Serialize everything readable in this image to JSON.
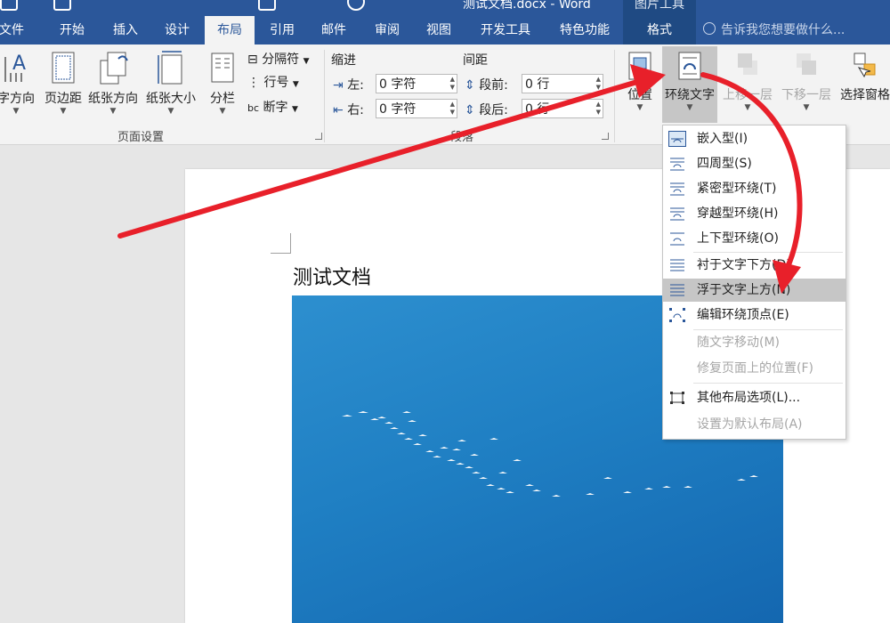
{
  "window": {
    "title": "测试文档.docx - Word",
    "context_tab": "图片工具"
  },
  "tabs": [
    {
      "label": "文件"
    },
    {
      "label": "开始"
    },
    {
      "label": "插入"
    },
    {
      "label": "设计"
    },
    {
      "label": "布局"
    },
    {
      "label": "引用"
    },
    {
      "label": "邮件"
    },
    {
      "label": "审阅"
    },
    {
      "label": "视图"
    },
    {
      "label": "开发工具"
    },
    {
      "label": "特色功能"
    },
    {
      "label": "格式"
    }
  ],
  "tell_me": "告诉我您想要做什么...",
  "ribbon": {
    "page_setup": {
      "text_direction": "字方向",
      "margins": "页边距",
      "orientation": "纸张方向",
      "size": "纸张大小",
      "columns": "分栏",
      "breaks": "分隔符",
      "line_numbers": "行号",
      "hyphenation": "断字",
      "group_label": "页面设置"
    },
    "paragraph": {
      "indent_label": "缩进",
      "spacing_label": "间距",
      "left_label": "左:",
      "left_value": "0 字符",
      "right_label": "右:",
      "right_value": "0 字符",
      "before_label": "段前:",
      "before_value": "0 行",
      "after_label": "段后:",
      "after_value": "0 行",
      "group_label": "段落"
    },
    "arrange": {
      "position": "位置",
      "wrap_text": "环绕文字",
      "bring_forward": "上移一层",
      "send_backward": "下移一层",
      "selection_pane": "选择窗格"
    }
  },
  "document": {
    "heading": "测试文档"
  },
  "wrap_menu": {
    "items": [
      {
        "label": "嵌入型(I)",
        "icon": "inline-icon"
      },
      {
        "label": "四周型(S)",
        "icon": "square-wrap-icon"
      },
      {
        "label": "紧密型环绕(T)",
        "icon": "tight-wrap-icon"
      },
      {
        "label": "穿越型环绕(H)",
        "icon": "through-wrap-icon"
      },
      {
        "label": "上下型环绕(O)",
        "icon": "top-bottom-wrap-icon"
      },
      {
        "label": "衬于文字下方(D)",
        "icon": "behind-text-icon"
      },
      {
        "label": "浮于文字上方(N)",
        "icon": "in-front-of-text-icon"
      },
      {
        "label": "编辑环绕顶点(E)",
        "icon": "edit-wrap-points-icon"
      },
      {
        "label": "随文字移动(M)",
        "icon": ""
      },
      {
        "label": "修复页面上的位置(F)",
        "icon": ""
      },
      {
        "label": "其他布局选项(L)...",
        "icon": "layout-options-icon"
      },
      {
        "label": "设置为默认布局(A)",
        "icon": ""
      }
    ],
    "highlighted": "浮于文字上方(N)"
  },
  "colors": {
    "accent": "#2b579a",
    "annotation_arrow": "#e8202a"
  }
}
